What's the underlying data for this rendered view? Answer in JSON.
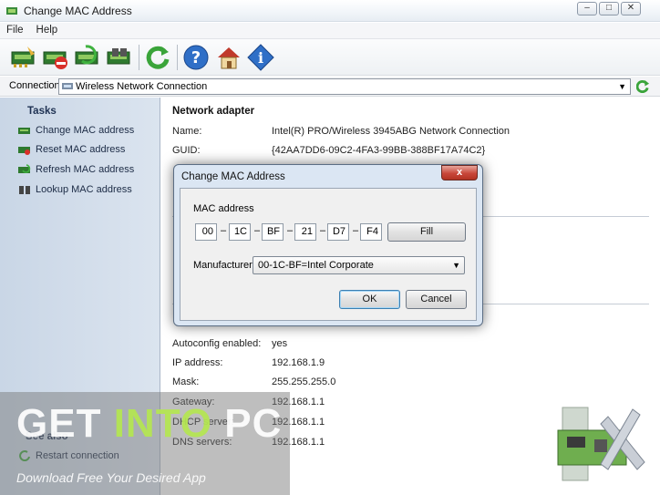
{
  "window": {
    "title": "Change MAC Address"
  },
  "menu": [
    "File",
    "Help"
  ],
  "toolbar": {
    "buttons": [
      "change-mac-icon",
      "reset-mac-icon",
      "refresh-mac-icon",
      "lookup-mac-icon",
      "refresh-icon",
      "help-icon",
      "home-icon",
      "info-icon"
    ]
  },
  "connection": {
    "label": "Connection:",
    "value": "Wireless Network Connection"
  },
  "tasks": {
    "header": "Tasks",
    "items": [
      "Change MAC address",
      "Reset MAC address",
      "Refresh MAC address",
      "Lookup MAC address"
    ],
    "see_also": {
      "header": "See also",
      "items": [
        "Restart connection"
      ]
    }
  },
  "adapter": {
    "header": "Network adapter",
    "name_label": "Name:",
    "name_value": "Intel(R) PRO/Wireless 3945ABG Network Connection",
    "guid_label": "GUID:",
    "guid_value": "{42AA7DD6-09C2-4FA3-99BB-388BF17A74C2}"
  },
  "ip": [
    {
      "k": "Autoconfig enabled:",
      "v": "yes"
    },
    {
      "k": "IP address:",
      "v": "192.168.1.9"
    },
    {
      "k": "Mask:",
      "v": "255.255.255.0"
    },
    {
      "k": "Gateway:",
      "v": "192.168.1.1"
    },
    {
      "k": "DHCP server:",
      "v": "192.168.1.1"
    },
    {
      "k": "DNS servers:",
      "v": "192.168.1.1"
    }
  ],
  "dialog": {
    "title": "Change MAC Address",
    "close": "x",
    "mac_label": "MAC address",
    "octets": [
      "00",
      "1C",
      "BF",
      "21",
      "D7",
      "F4"
    ],
    "separator": "–",
    "fill": "Fill",
    "manufacturer_label": "Manufacturer",
    "manufacturer_value": "00-1C-BF=Intel Corporate",
    "ok": "OK",
    "cancel": "Cancel"
  },
  "watermark": {
    "part1": "GET ",
    "part2": "INTO",
    "part3": " PC",
    "tagline": "Download Free Your Desired App"
  },
  "colors": {
    "accent": "#3c7fb1",
    "taskpane": "#c9d6e6",
    "close_red": "#c8473a"
  }
}
